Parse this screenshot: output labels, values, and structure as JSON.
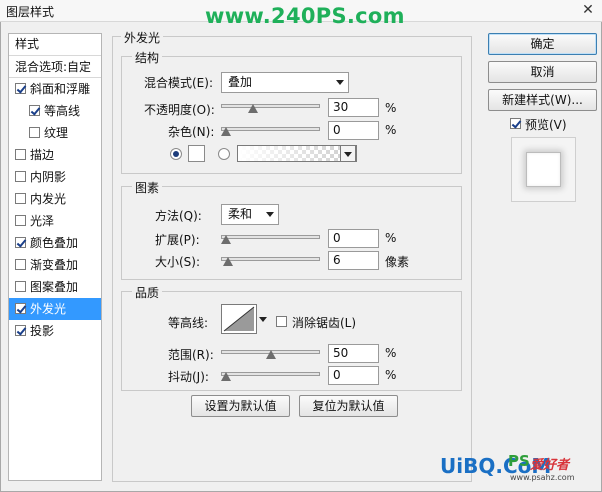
{
  "window": {
    "title": "图层样式",
    "watermark": "www.240PS.com",
    "close_glyph": "✕"
  },
  "style_list": {
    "header": "样式",
    "blend_options": "混合选项:自定",
    "items": [
      {
        "label": "斜面和浮雕",
        "checked": true,
        "indent": false,
        "selected": false
      },
      {
        "label": "等高线",
        "checked": true,
        "indent": true,
        "selected": false
      },
      {
        "label": "纹理",
        "checked": false,
        "indent": true,
        "selected": false
      },
      {
        "label": "描边",
        "checked": false,
        "indent": false,
        "selected": false
      },
      {
        "label": "内阴影",
        "checked": false,
        "indent": false,
        "selected": false
      },
      {
        "label": "内发光",
        "checked": false,
        "indent": false,
        "selected": false
      },
      {
        "label": "光泽",
        "checked": false,
        "indent": false,
        "selected": false
      },
      {
        "label": "颜色叠加",
        "checked": true,
        "indent": false,
        "selected": false
      },
      {
        "label": "渐变叠加",
        "checked": false,
        "indent": false,
        "selected": false
      },
      {
        "label": "图案叠加",
        "checked": false,
        "indent": false,
        "selected": false
      },
      {
        "label": "外发光",
        "checked": true,
        "indent": false,
        "selected": true
      },
      {
        "label": "投影",
        "checked": true,
        "indent": false,
        "selected": false
      }
    ]
  },
  "outer_glow": {
    "title": "外发光",
    "structure": {
      "title": "结构",
      "blend_mode_label": "混合模式(E):",
      "blend_mode_value": "叠加",
      "opacity_label": "不透明度(O):",
      "opacity_value": "30",
      "opacity_level": 0.3,
      "noise_label": "杂色(N):",
      "noise_value": "0",
      "noise_level": 0,
      "percent": "%"
    },
    "elements": {
      "title": "图素",
      "technique_label": "方法(Q):",
      "technique_value": "柔和",
      "spread_label": "扩展(P):",
      "spread_value": "0",
      "spread_level": 0,
      "size_label": "大小(S):",
      "size_value": "6",
      "size_level": 0.025,
      "percent": "%",
      "pixels": "像素"
    },
    "quality": {
      "title": "品质",
      "contour_label": "等高线:",
      "antialias_label": "消除锯齿(L)",
      "antialias_checked": false,
      "range_label": "范围(R):",
      "range_value": "50",
      "range_level": 0.5,
      "jitter_label": "抖动(J):",
      "jitter_value": "0",
      "jitter_level": 0,
      "percent": "%"
    },
    "make_default": "设置为默认值",
    "reset_default": "复位为默认值"
  },
  "right_panel": {
    "ok": "确定",
    "cancel": "取消",
    "new_style": "新建样式(W)...",
    "preview_label": "预览(V)",
    "preview_checked": true
  },
  "brand": {
    "logo": "UiBQ.CoM",
    "ps": "PS",
    "cn": "爱好者",
    "url": "www.psahz.com"
  }
}
